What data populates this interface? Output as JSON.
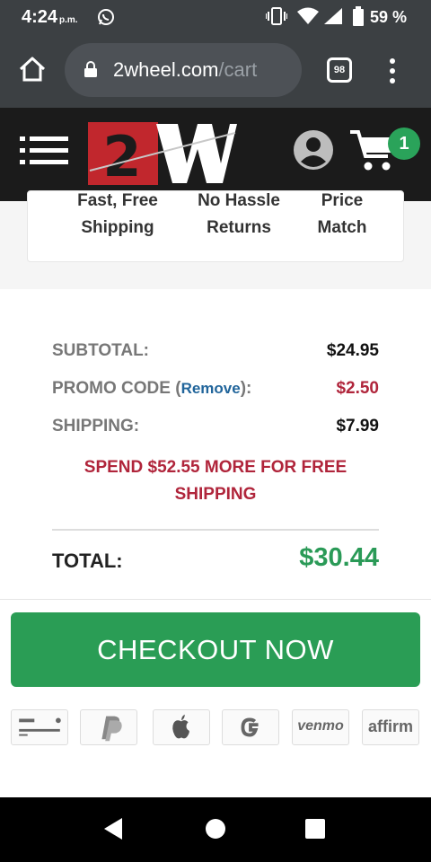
{
  "status_bar": {
    "time": "4:24",
    "ampm": "p.m.",
    "battery": "59 %"
  },
  "browser": {
    "url_host": "2wheel.com",
    "url_path": "/cart",
    "tab_count": "98"
  },
  "site_header": {
    "logo_text": "2W",
    "cart_count": "1"
  },
  "features": [
    {
      "line1": "Fast, Free",
      "line2": "Shipping"
    },
    {
      "line1": "No Hassle",
      "line2": "Returns"
    },
    {
      "line1": "Price",
      "line2": "Match"
    }
  ],
  "summary": {
    "subtotal_label": "SUBTOTAL:",
    "subtotal_value": "$24.95",
    "promo_label_prefix": "PROMO CODE (",
    "promo_remove": "Remove",
    "promo_label_suffix": "):",
    "promo_value": "$2.50",
    "shipping_label": "SHIPPING:",
    "shipping_value": "$7.99",
    "free_shipping_msg": "SPEND $52.55 MORE FOR FREE SHIPPING",
    "total_label": "TOTAL:",
    "total_value": "$30.44"
  },
  "checkout": {
    "button_label": "CHECKOUT NOW"
  },
  "payment_methods": {
    "venmo": "venmo",
    "affirm": "affirm"
  },
  "colors": {
    "brand_red": "#c1272d",
    "accent_green": "#2a9d55",
    "promo_red": "#b0253b",
    "link_blue": "#21659b"
  }
}
